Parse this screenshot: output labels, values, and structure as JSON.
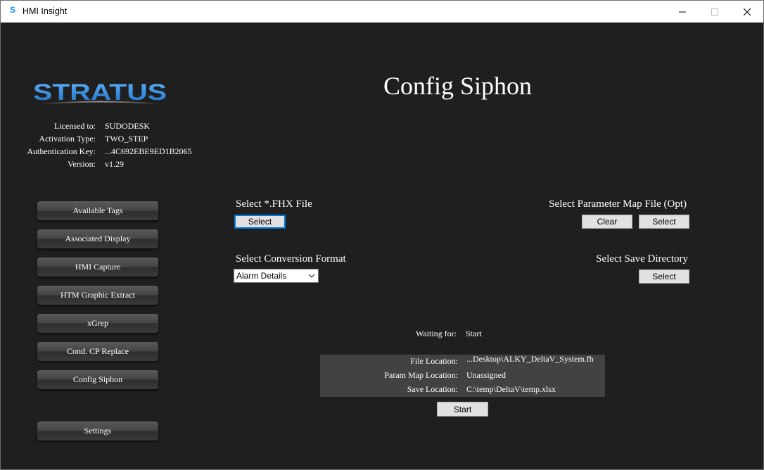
{
  "window": {
    "title": "HMI Insight",
    "icon": "S"
  },
  "brand": {
    "logo_text": "STRATUS"
  },
  "license": {
    "licensed_to_label": "Licensed to:",
    "licensed_to": "SUDODESK",
    "activation_label": "Activation Type:",
    "activation": "TWO_STEP",
    "auth_label": "Authentication Key:",
    "auth_key": "...4C692EBE9ED1B2065",
    "version_label": "Version:",
    "version": "v1.29"
  },
  "nav": {
    "items": [
      "Available Tags",
      "Associated Display",
      "HMI Capture",
      "HTM Graphic Extract",
      "xGrep",
      "Cond. CP Replace",
      "Config Siphon"
    ],
    "settings": "Settings"
  },
  "page": {
    "title": "Config Siphon"
  },
  "fhx": {
    "label": "Select *.FHX File",
    "select": "Select"
  },
  "param_map": {
    "label": "Select Parameter Map File (Opt)",
    "clear": "Clear",
    "select": "Select"
  },
  "conversion": {
    "label": "Select Conversion Format",
    "value": "Alarm Details"
  },
  "save_dir": {
    "label": "Select Save Directory",
    "select": "Select"
  },
  "status": {
    "waiting_label": "Waiting for:",
    "waiting_value": "Start",
    "file_label": "File Location:",
    "file_value": "...Desktop\\ALKY_DeltaV_System.fh",
    "param_label": "Param Map Location:",
    "param_value": "Unassigned",
    "save_label": "Save Location:",
    "save_value": "C:\\temp\\DeltaV\\temp.xlsx"
  },
  "start": "Start",
  "colors": {
    "background": "#1f1f1f",
    "logo_blue": "#2f8fe0",
    "focus_border": "#0078d7",
    "panel": "#424242"
  }
}
